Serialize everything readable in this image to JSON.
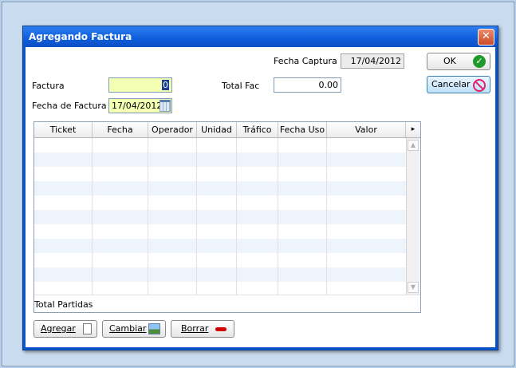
{
  "dialog": {
    "title": "Agregando Factura",
    "close_glyph": "✕"
  },
  "form": {
    "fecha_captura_label": "Fecha Captura",
    "fecha_captura_value": "17/04/2012",
    "factura_label": "Factura",
    "factura_value": "0",
    "total_fac_label": "Total Fac",
    "total_fac_value": "0.00",
    "fecha_factura_label": "Fecha de Factura",
    "fecha_factura_value": "17/04/2012"
  },
  "buttons": {
    "ok": "OK",
    "cancelar": "Cancelar",
    "agregar": "Agregar",
    "cambiar": "Cambiar",
    "borrar": "Borrar"
  },
  "table": {
    "columns": [
      "Ticket",
      "Fecha",
      "Operador",
      "Unidad",
      "Tráfico",
      "Fecha Uso",
      "Valor"
    ],
    "more_glyph": "▸",
    "total_label": "Total Partidas"
  },
  "colors": {
    "titlebar": "#0f5ddb",
    "required_field": "#f3ffb3",
    "ok_icon": "#1f9a2a",
    "cancel_icon": "#e0206a",
    "borrar_icon": "#d10000"
  }
}
